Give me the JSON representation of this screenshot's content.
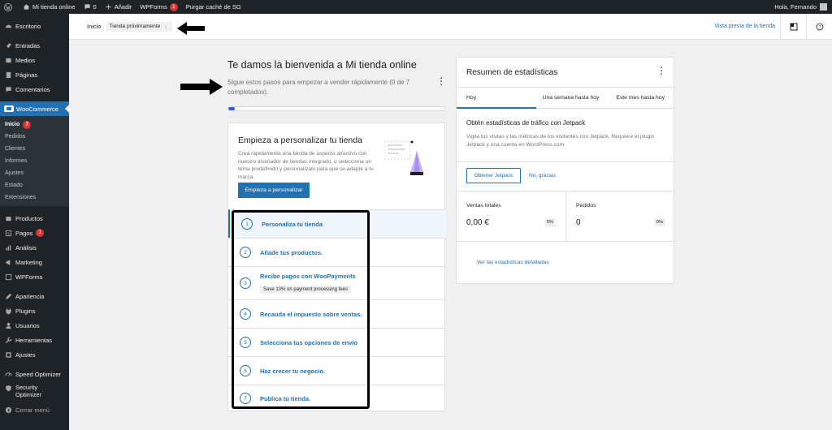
{
  "admin_bar": {
    "site_name": "Mi tienda online",
    "comments_count": "0",
    "new_label": "Añadir",
    "wpforms_label": "WPForms",
    "wpforms_badge": "1",
    "purge_label": "Purgar caché de SG",
    "greeting": "Hola, Fernando"
  },
  "sidebar": {
    "items_top": [
      {
        "label": "Escritorio",
        "icon": "dashboard-icon"
      }
    ],
    "items_mid": [
      {
        "label": "Entradas",
        "icon": "pin-icon"
      },
      {
        "label": "Medios",
        "icon": "media-icon"
      },
      {
        "label": "Páginas",
        "icon": "page-icon"
      },
      {
        "label": "Comentarios",
        "icon": "comment-icon"
      }
    ],
    "woocommerce": "WooCommerce",
    "woo_sub": [
      {
        "label": "Inicio",
        "badge": "7"
      },
      {
        "label": "Pedidos"
      },
      {
        "label": "Clientes"
      },
      {
        "label": "Informes"
      },
      {
        "label": "Ajustes"
      },
      {
        "label": "Estado"
      },
      {
        "label": "Extensiones"
      }
    ],
    "items_low": [
      {
        "label": "Productos",
        "icon": "products-icon"
      },
      {
        "label": "Pagos",
        "icon": "payments-icon",
        "badge": "1"
      },
      {
        "label": "Análisis",
        "icon": "analytics-icon"
      },
      {
        "label": "Marketing",
        "icon": "marketing-icon"
      },
      {
        "label": "WPForms",
        "icon": "wpforms-icon"
      }
    ],
    "items_tools": [
      {
        "label": "Apariencia",
        "icon": "appearance-icon"
      },
      {
        "label": "Plugins",
        "icon": "plugins-icon"
      },
      {
        "label": "Usuarios",
        "icon": "users-icon"
      },
      {
        "label": "Herramientas",
        "icon": "tools-icon"
      },
      {
        "label": "Ajustes",
        "icon": "settings-icon"
      }
    ],
    "speed_optimizer": "Speed Optimizer",
    "security_line1": "Security",
    "security_line2": "Optimizer",
    "collapse": "Cerrar menú"
  },
  "header": {
    "breadcrumb": "Inicio",
    "status_pill": "Tienda próximamente",
    "preview_link": "Vista previa de la tienda"
  },
  "welcome": {
    "title": "Te damos la bienvenida a Mi tienda online",
    "subtitle": "Sigue estos pasos para empezar a vender rápidamente (0 de 7 completados).",
    "progress_fraction": 0.03
  },
  "setup": {
    "title": "Empieza a personalizar tu tienda",
    "description": "Crea rápidamente una tienda de aspecto atractivo con nuestro diseñador de tiendas integrado, o selecciona un tema predefinido y personalízalo para que se adapte a tu marca.",
    "button": "Empieza a personalizar",
    "tasks": [
      {
        "num": "1",
        "label": "Personaliza tu tienda"
      },
      {
        "num": "2",
        "label": "Añade tus productos."
      },
      {
        "num": "3",
        "label": "Recibe pagos con WooPayments",
        "sub": "Save 10% on payment processing fees"
      },
      {
        "num": "4",
        "label": "Recauda el impuesto sobre ventas."
      },
      {
        "num": "5",
        "label": "Selecciona tus opciones de envío"
      },
      {
        "num": "6",
        "label": "Haz crecer tu negocio."
      },
      {
        "num": "7",
        "label": "Publica tu tienda."
      }
    ]
  },
  "stats": {
    "title": "Resumen de estadísticas",
    "tabs": [
      "Hoy",
      "Una semana hasta hoy",
      "Este mes hasta hoy"
    ],
    "jetpack_title": "Obtén estadísticas de tráfico con Jetpack",
    "jetpack_desc": "Vigila tus visitas y las métricas de los visitantes con Jetpack. Requiere el plugin Jetpack y una cuenta en WordPress.com",
    "jetpack_button": "Obtener Jetpack",
    "no_thanks": "No, gracias",
    "metrics": [
      {
        "label": "Ventas totales",
        "value": "0,00 €",
        "pct": "0%"
      },
      {
        "label": "Pedidos",
        "value": "0",
        "pct": "0%"
      }
    ],
    "details_link": "Ver las estadísticas detalladas"
  }
}
